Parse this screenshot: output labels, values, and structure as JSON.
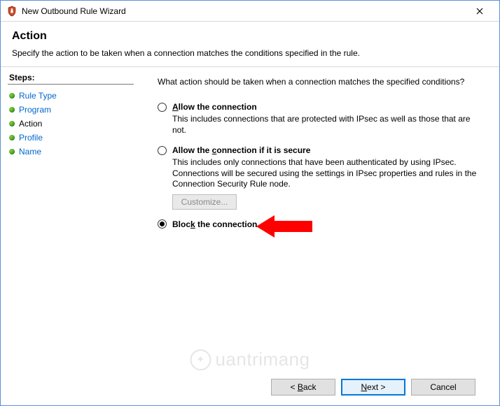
{
  "window": {
    "title": "New Outbound Rule Wizard"
  },
  "header": {
    "heading": "Action",
    "subtitle": "Specify the action to be taken when a connection matches the conditions specified in the rule."
  },
  "steps": {
    "title": "Steps:",
    "items": [
      {
        "label": "Rule Type",
        "current": false
      },
      {
        "label": "Program",
        "current": false
      },
      {
        "label": "Action",
        "current": true
      },
      {
        "label": "Profile",
        "current": false
      },
      {
        "label": "Name",
        "current": false
      }
    ]
  },
  "main": {
    "prompt": "What action should be taken when a connection matches the specified conditions?",
    "options": [
      {
        "id": "allow",
        "label_pre": "",
        "label_u": "A",
        "label_post": "llow the connection",
        "desc": "This includes connections that are protected with IPsec as well as those that are not.",
        "checked": false
      },
      {
        "id": "allow-secure",
        "label_pre": "Allow the ",
        "label_u": "c",
        "label_post": "onnection if it is secure",
        "desc": "This includes only connections that have been authenticated by using IPsec. Connections will be secured using the settings in IPsec properties and rules in the Connection Security Rule node.",
        "checked": false
      },
      {
        "id": "block",
        "label_pre": "Bloc",
        "label_u": "k",
        "label_post": " the connection",
        "desc": "",
        "checked": true
      }
    ],
    "customize_label": "Customize...",
    "customize_enabled": false
  },
  "footer": {
    "back_pre": "< ",
    "back_u": "B",
    "back_post": "ack",
    "next_pre": "",
    "next_u": "N",
    "next_post": "ext >",
    "cancel": "Cancel"
  },
  "watermark": {
    "text": "uantrimang"
  }
}
